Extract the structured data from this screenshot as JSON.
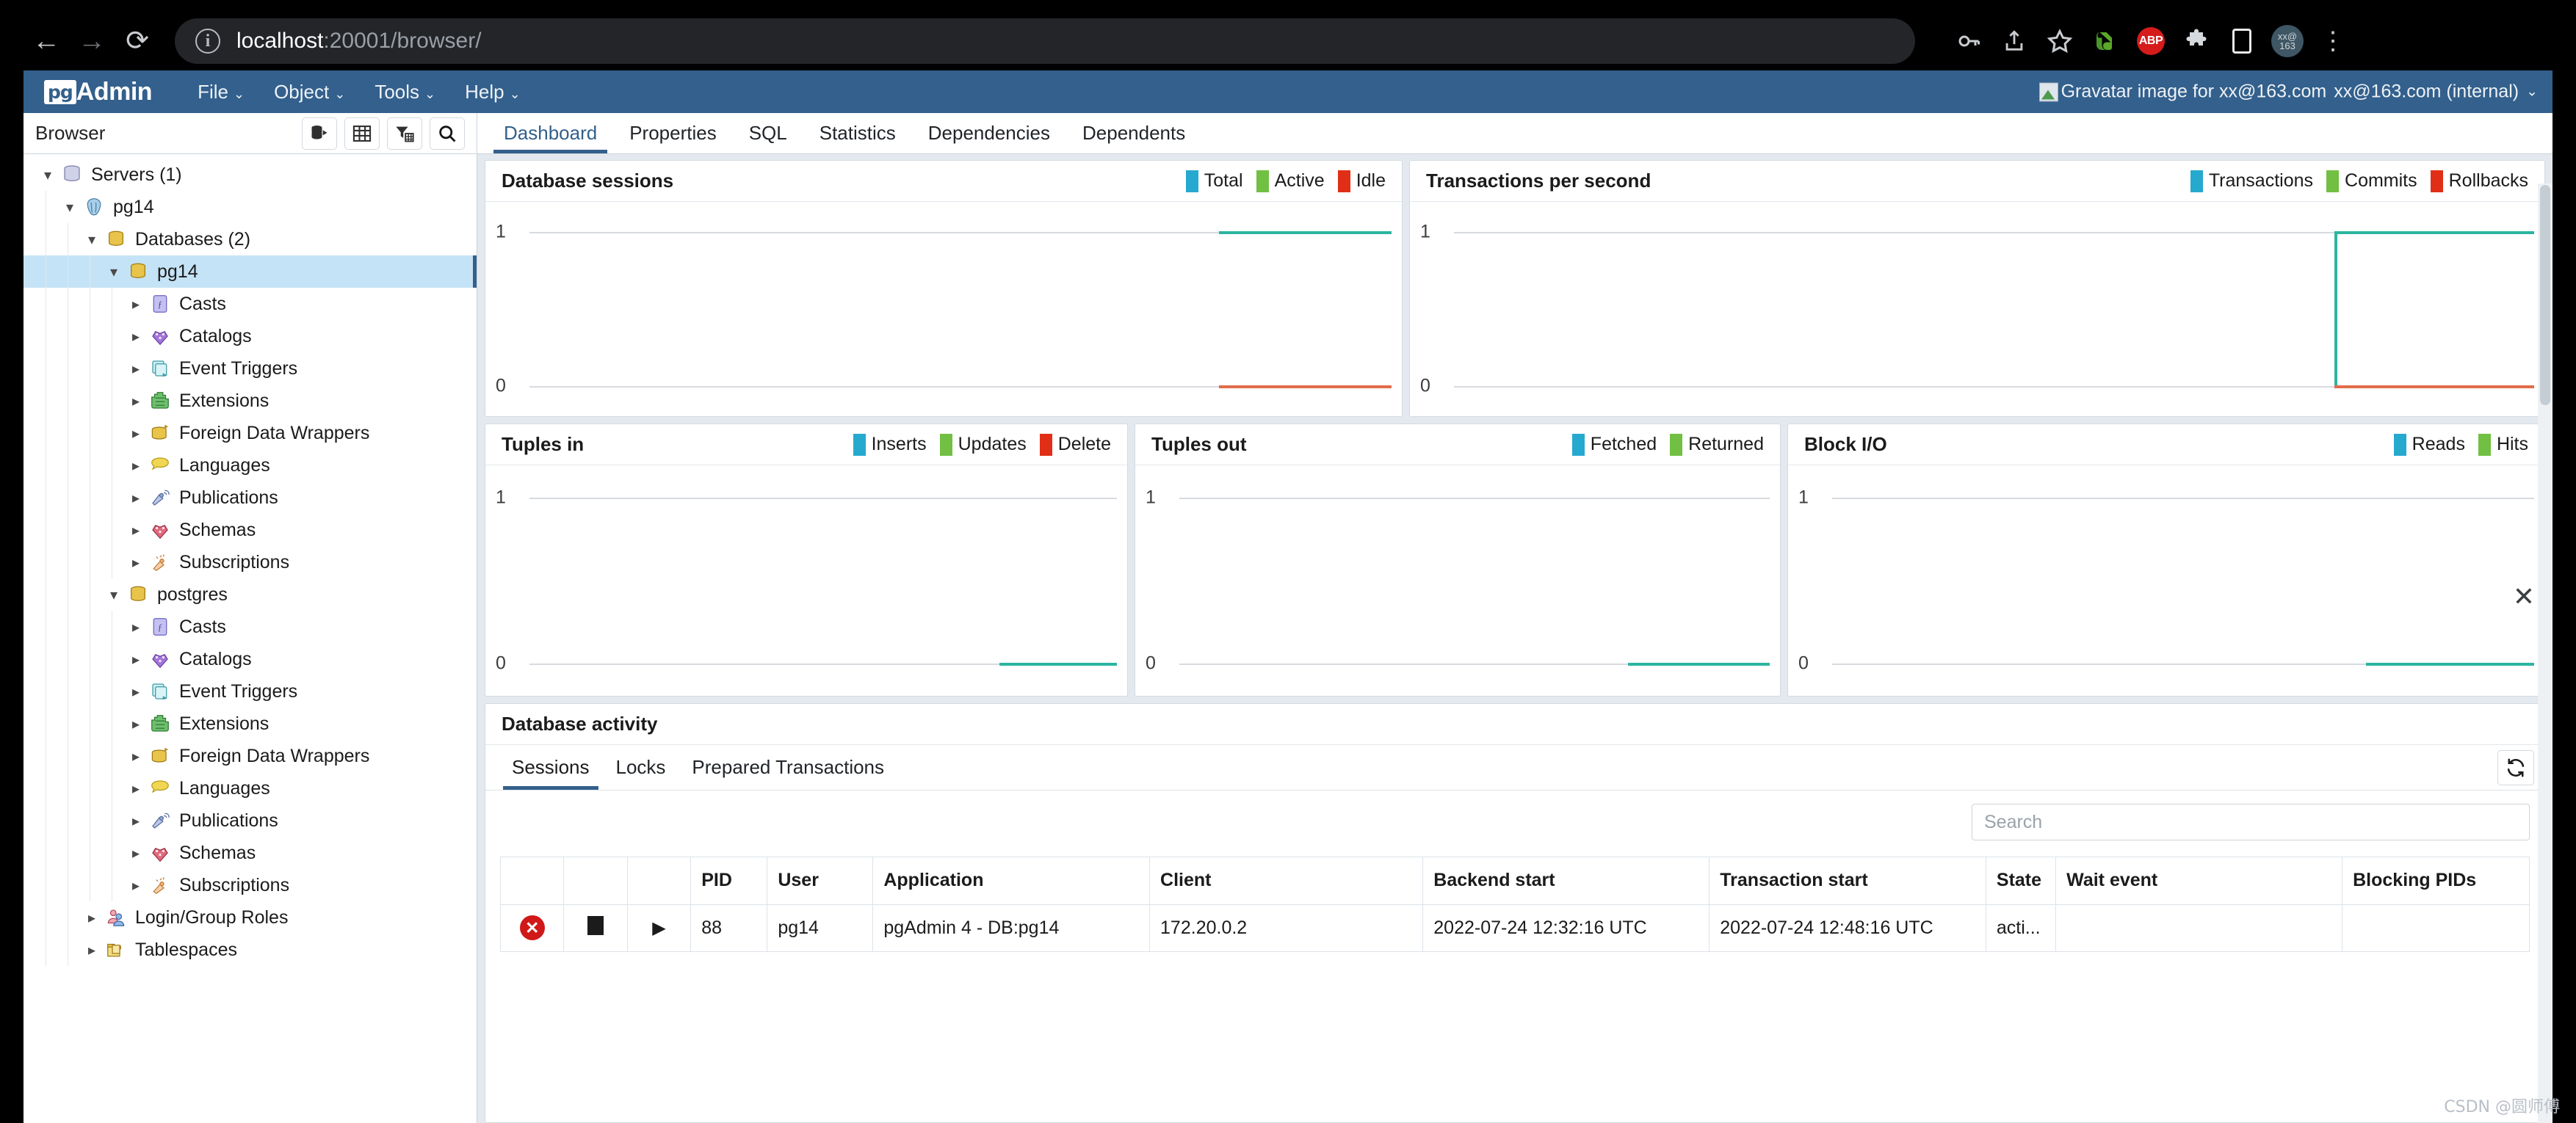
{
  "browser": {
    "back_icon": "back-arrow-icon",
    "forward_icon": "forward-arrow-icon",
    "reload_icon": "reload-icon",
    "site_info_icon": "site-info-icon",
    "url_host": "localhost",
    "url_path": ":20001/browser/",
    "url_full": "localhost:20001/browser/",
    "actions": [
      {
        "name": "password-key-icon",
        "glyph": "⚷"
      },
      {
        "name": "share-icon",
        "glyph": "⇧"
      },
      {
        "name": "bookmark-star-icon",
        "glyph": "☆"
      }
    ],
    "extensions": [
      {
        "name": "evernote-extension-icon",
        "label": ""
      },
      {
        "name": "adblock-plus-extension-icon",
        "label": "ABP"
      },
      {
        "name": "extensions-puzzle-icon",
        "label": ""
      },
      {
        "name": "side-panel-icon",
        "label": ""
      },
      {
        "name": "profile-avatar-icon",
        "label": ""
      },
      {
        "name": "chrome-menu-kebab-icon",
        "label": "⋮"
      }
    ]
  },
  "header": {
    "logo_mark": "pg",
    "logo_text": "Admin",
    "menus": [
      {
        "label": "File"
      },
      {
        "label": "Object"
      },
      {
        "label": "Tools"
      },
      {
        "label": "Help"
      }
    ],
    "caret": "⌄",
    "user_avatar_alt": "Gravatar image for xx@163.com",
    "user_label": "xx@163.com (internal)"
  },
  "sidebar": {
    "title": "Browser",
    "tools": [
      {
        "name": "query-tool-icon",
        "title": "Query Tool"
      },
      {
        "name": "view-data-grid-icon",
        "title": "View Data"
      },
      {
        "name": "filtered-rows-icon",
        "title": "Filtered Rows"
      },
      {
        "name": "search-objects-icon",
        "title": "Search Objects"
      }
    ],
    "tree": [
      {
        "label": "Servers (1)",
        "depth": 0,
        "state": "open",
        "icon": "servers-icon",
        "selected": false
      },
      {
        "label": "pg14",
        "depth": 1,
        "state": "open",
        "icon": "postgres-server-icon",
        "selected": false
      },
      {
        "label": "Databases (2)",
        "depth": 2,
        "state": "open",
        "icon": "databases-icon",
        "selected": false
      },
      {
        "label": "pg14",
        "depth": 3,
        "state": "open",
        "icon": "database-icon",
        "selected": true
      },
      {
        "label": "Casts",
        "depth": 4,
        "state": "closed",
        "icon": "casts-icon",
        "selected": false
      },
      {
        "label": "Catalogs",
        "depth": 4,
        "state": "closed",
        "icon": "catalogs-icon",
        "selected": false
      },
      {
        "label": "Event Triggers",
        "depth": 4,
        "state": "closed",
        "icon": "event-triggers-icon",
        "selected": false
      },
      {
        "label": "Extensions",
        "depth": 4,
        "state": "closed",
        "icon": "extensions-icon",
        "selected": false
      },
      {
        "label": "Foreign Data Wrappers",
        "depth": 4,
        "state": "closed",
        "icon": "fdw-icon",
        "selected": false
      },
      {
        "label": "Languages",
        "depth": 4,
        "state": "closed",
        "icon": "languages-icon",
        "selected": false
      },
      {
        "label": "Publications",
        "depth": 4,
        "state": "closed",
        "icon": "publications-icon",
        "selected": false
      },
      {
        "label": "Schemas",
        "depth": 4,
        "state": "closed",
        "icon": "schemas-icon",
        "selected": false
      },
      {
        "label": "Subscriptions",
        "depth": 4,
        "state": "closed",
        "icon": "subscriptions-icon",
        "selected": false
      },
      {
        "label": "postgres",
        "depth": 3,
        "state": "open",
        "icon": "database-icon",
        "selected": false
      },
      {
        "label": "Casts",
        "depth": 4,
        "state": "closed",
        "icon": "casts-icon",
        "selected": false
      },
      {
        "label": "Catalogs",
        "depth": 4,
        "state": "closed",
        "icon": "catalogs-icon",
        "selected": false
      },
      {
        "label": "Event Triggers",
        "depth": 4,
        "state": "closed",
        "icon": "event-triggers-icon",
        "selected": false
      },
      {
        "label": "Extensions",
        "depth": 4,
        "state": "closed",
        "icon": "extensions-icon",
        "selected": false
      },
      {
        "label": "Foreign Data Wrappers",
        "depth": 4,
        "state": "closed",
        "icon": "fdw-icon",
        "selected": false
      },
      {
        "label": "Languages",
        "depth": 4,
        "state": "closed",
        "icon": "languages-icon",
        "selected": false
      },
      {
        "label": "Publications",
        "depth": 4,
        "state": "closed",
        "icon": "publications-icon",
        "selected": false
      },
      {
        "label": "Schemas",
        "depth": 4,
        "state": "closed",
        "icon": "schemas-icon",
        "selected": false
      },
      {
        "label": "Subscriptions",
        "depth": 4,
        "state": "closed",
        "icon": "subscriptions-icon",
        "selected": false
      },
      {
        "label": "Login/Group Roles",
        "depth": 2,
        "state": "closed",
        "icon": "roles-icon",
        "selected": false
      },
      {
        "label": "Tablespaces",
        "depth": 2,
        "state": "closed",
        "icon": "tablespaces-icon",
        "selected": false
      }
    ]
  },
  "tabs": [
    {
      "label": "Dashboard",
      "active": true
    },
    {
      "label": "Properties",
      "active": false
    },
    {
      "label": "SQL",
      "active": false
    },
    {
      "label": "Statistics",
      "active": false
    },
    {
      "label": "Dependencies",
      "active": false
    },
    {
      "label": "Dependents",
      "active": false
    }
  ],
  "close_tab_glyph": "✕",
  "colors": {
    "accent": "#33608c",
    "legend_blue": "#26a9cf",
    "legend_green": "#72c043",
    "legend_red": "#e02f16",
    "line_teal": "#2cb5a0",
    "line_orange": "#e06c49"
  },
  "chart_data": [
    {
      "type": "line",
      "title": "Database sessions",
      "legend": [
        {
          "name": "Total",
          "color": "#26a9cf"
        },
        {
          "name": "Active",
          "color": "#72c043"
        },
        {
          "name": "Idle",
          "color": "#e02f16"
        }
      ],
      "yticks": [
        "0",
        "1"
      ],
      "ylim": [
        0,
        1
      ],
      "grid": true,
      "series": [
        {
          "name": "Total",
          "color": "#2cb5a0",
          "values": [
            1,
            1,
            1,
            1,
            1
          ],
          "x_start_frac": 0.8,
          "level": 1
        },
        {
          "name": "Idle",
          "color": "#e06c49",
          "values": [
            0,
            0,
            0,
            0,
            0
          ],
          "x_start_frac": 0.8,
          "level": 0
        }
      ]
    },
    {
      "type": "line",
      "title": "Transactions per second",
      "legend": [
        {
          "name": "Transactions",
          "color": "#26a9cf"
        },
        {
          "name": "Commits",
          "color": "#72c043"
        },
        {
          "name": "Rollbacks",
          "color": "#e02f16"
        }
      ],
      "yticks": [
        "0",
        "1"
      ],
      "ylim": [
        0,
        1
      ],
      "grid": true,
      "series": [
        {
          "name": "Transactions",
          "color": "#2cb5a0",
          "values": [
            0,
            1,
            1,
            1,
            1
          ],
          "x_start_frac": 0.815,
          "level": 1,
          "step": true
        },
        {
          "name": "Rollbacks",
          "color": "#e06c49",
          "values": [
            0,
            0,
            0,
            0,
            0
          ],
          "x_start_frac": 0.815,
          "level": 0
        }
      ]
    },
    {
      "type": "line",
      "title": "Tuples in",
      "legend": [
        {
          "name": "Inserts",
          "color": "#26a9cf"
        },
        {
          "name": "Updates",
          "color": "#72c043"
        },
        {
          "name": "Delete",
          "color": "#e02f16"
        }
      ],
      "yticks": [
        "0",
        "1"
      ],
      "ylim": [
        0,
        1
      ],
      "grid": true,
      "series": [
        {
          "name": "Inserts",
          "color": "#2cb5a0",
          "values": [
            0,
            0,
            0,
            0,
            0
          ],
          "x_start_frac": 0.8,
          "level": 0
        }
      ]
    },
    {
      "type": "line",
      "title": "Tuples out",
      "legend": [
        {
          "name": "Fetched",
          "color": "#26a9cf"
        },
        {
          "name": "Returned",
          "color": "#72c043"
        }
      ],
      "yticks": [
        "0",
        "1"
      ],
      "ylim": [
        0,
        1
      ],
      "grid": true,
      "series": [
        {
          "name": "Fetched",
          "color": "#2cb5a0",
          "values": [
            0,
            0,
            0,
            0,
            0
          ],
          "x_start_frac": 0.76,
          "level": 0
        }
      ]
    },
    {
      "type": "line",
      "title": "Block I/O",
      "legend": [
        {
          "name": "Reads",
          "color": "#26a9cf"
        },
        {
          "name": "Hits",
          "color": "#72c043"
        }
      ],
      "yticks": [
        "0",
        "1"
      ],
      "ylim": [
        0,
        1
      ],
      "grid": true,
      "series": [
        {
          "name": "Reads",
          "color": "#2cb5a0",
          "values": [
            0,
            0,
            0,
            0,
            0
          ],
          "x_start_frac": 0.76,
          "level": 0
        }
      ]
    }
  ],
  "activity": {
    "title": "Database activity",
    "tabs": [
      {
        "label": "Sessions",
        "active": true
      },
      {
        "label": "Locks",
        "active": false
      },
      {
        "label": "Prepared Transactions",
        "active": false
      }
    ],
    "refresh_icon": "refresh-icon",
    "search_placeholder": "Search",
    "search_value": "",
    "columns": [
      "",
      "",
      "",
      "PID",
      "User",
      "Application",
      "Client",
      "Backend start",
      "Transaction start",
      "State",
      "Wait event",
      "Blocking PIDs"
    ],
    "rows": [
      {
        "cancel_icon": "cancel-query-icon",
        "terminate_icon": "terminate-session-icon",
        "expand_icon": "expand-row-icon",
        "pid": "88",
        "user": "pg14",
        "application": "pgAdmin 4 - DB:pg14",
        "client": "172.20.0.2",
        "backend_start": "2022-07-24 12:32:16 UTC",
        "transaction_start": "2022-07-24 12:48:16 UTC",
        "state": "acti...",
        "wait_event": "",
        "blocking_pids": ""
      }
    ]
  },
  "watermark": "CSDN @圆师傅"
}
